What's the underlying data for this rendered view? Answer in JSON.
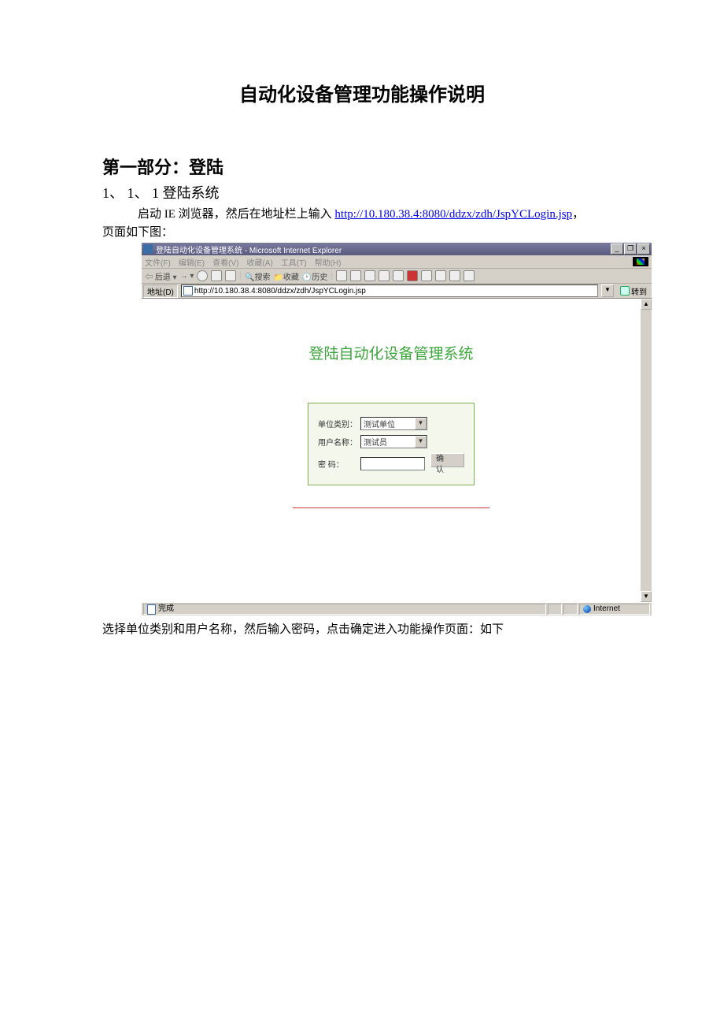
{
  "doc": {
    "title": "自动化设备管理功能操作说明",
    "section1": "第一部分：登陆",
    "sub1": "1、  1、  1 登陆系统",
    "para1_pre": "启动 IE 浏览器，然后在地址栏上输入 ",
    "url": "http://10.180.38.4:8080/ddzx/zdh/JspYCLogin.jsp",
    "para1_post": "，",
    "para2": "页面如下图：",
    "after": "选择单位类别和用户名称，然后输入密码，点击确定进入功能操作页面：如下"
  },
  "ie": {
    "title": "登陆自动化设备管理系统 - Microsoft Internet Explorer",
    "menus": [
      "文件(F)",
      "编辑(E)",
      "查看(V)",
      "收藏(A)",
      "工具(T)",
      "帮助(H)"
    ],
    "back": "后退",
    "search": "搜索",
    "fav": "收藏",
    "history": "历史",
    "addr_label": "地址(D)",
    "addr_value": "http://10.180.38.4:8080/ddzx/zdh/JspYCLogin.jsp",
    "go": "转到",
    "status_done": "完成",
    "status_zone": "Internet"
  },
  "login": {
    "heading": "登陆自动化设备管理系统",
    "unit_label": "单位类别：",
    "unit_value": "测试单位",
    "user_label": "用户名称：",
    "user_value": "测试员",
    "pwd_label": "密 码：",
    "confirm": "确  认"
  }
}
